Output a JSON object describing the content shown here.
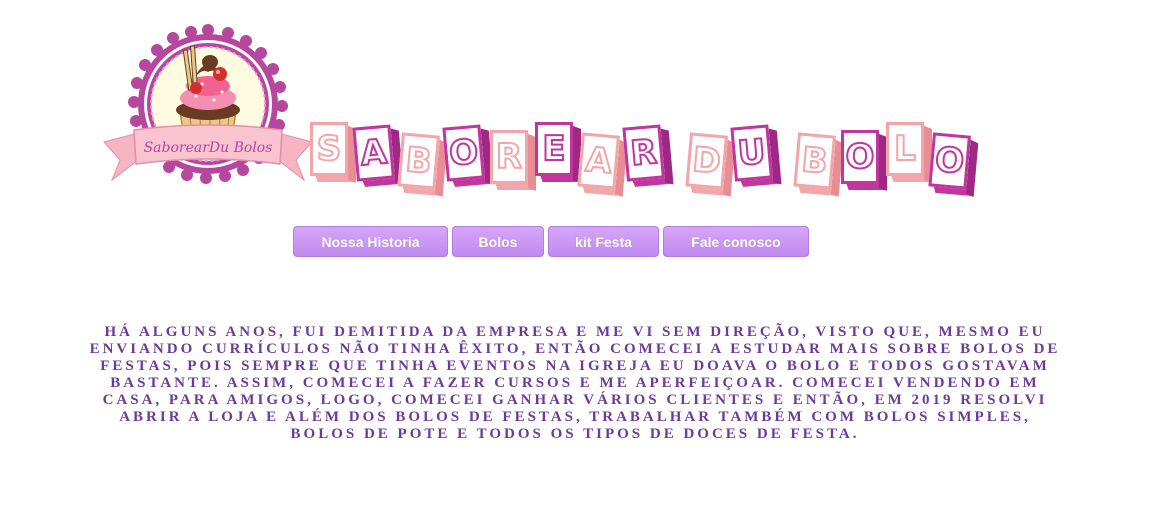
{
  "logo": {
    "text": "SaborearDu Bolos",
    "colors": {
      "ring": "#b5489e",
      "ring_inner": "#fffbe0",
      "ribbon": "#f7b5c3",
      "frosting_chocolate": "#6b3a22",
      "frosting_pink": "#f48fb1",
      "cup": "#e9c98a",
      "cherry": "#d32f2f"
    }
  },
  "title": {
    "words": [
      "SABOREAR",
      "DU",
      "BOLO"
    ],
    "colors": {
      "pink": "#f2a6aa",
      "magenta": "#c0359e"
    }
  },
  "nav": {
    "items": [
      {
        "label": "Nossa Historia"
      },
      {
        "label": "Bolos"
      },
      {
        "label": "kit Festa"
      },
      {
        "label": "Fale conosco"
      }
    ],
    "colors": {
      "button_bg": "#c99af5",
      "button_text": "#ffffff"
    }
  },
  "story": {
    "text": "HÁ ALGUNS ANOS, FUI DEMITIDA DA EMPRESA E ME VI SEM DIREÇÃO, VISTO QUE, MESMO EU ENVIANDO CURRÍCULOS NÃO TINHA ÊXITO, ENTÃO COMECEI A ESTUDAR MAIS SOBRE BOLOS DE FESTAS, POIS SEMPRE QUE TINHA EVENTOS NA IGREJA EU DOAVA O BOLO E TODOS GOSTAVAM BASTANTE. ASSIM, COMECEI A FAZER CURSOS E ME APERFEIÇOAR. COMECEI VENDENDO EM CASA, PARA AMIGOS, LOGO, COMECEI GANHAR VÁRIOS CLIENTES E ENTÃO, EM 2019 RESOLVI ABRIR A LOJA E ALÉM DOS BOLOS DE FESTAS, TRABALHAR TAMBÉM COM BOLOS SIMPLES, BOLOS DE POTE E TODOS OS TIPOS DE DOCES DE FESTA.",
    "color": "#6b3a9a"
  }
}
